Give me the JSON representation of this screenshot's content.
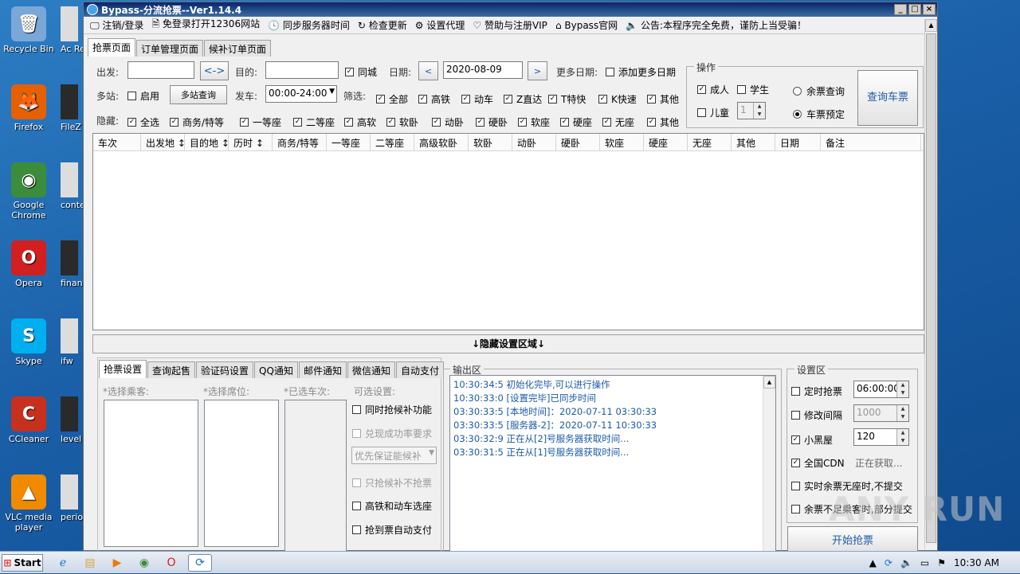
{
  "desktop": {
    "icons": [
      {
        "label": "Recycle Bin",
        "icon": "recycle-bin-icon",
        "color": "#7aa7d8",
        "glyph": "🗑"
      },
      {
        "label": "Firefox",
        "icon": "firefox-icon",
        "color": "#e66000",
        "glyph": "🦊"
      },
      {
        "label": "Google Chrome",
        "icon": "chrome-icon",
        "color": "#3b8d3b",
        "glyph": "◉"
      },
      {
        "label": "Opera",
        "icon": "opera-icon",
        "color": "#d21f1f",
        "glyph": "O"
      },
      {
        "label": "Skype",
        "icon": "skype-icon",
        "color": "#00aff0",
        "glyph": "S"
      },
      {
        "label": "CCleaner",
        "icon": "ccleaner-icon",
        "color": "#c8301e",
        "glyph": "C"
      },
      {
        "label": "VLC media player",
        "icon": "vlc-icon",
        "color": "#f08a00",
        "glyph": "▲"
      }
    ],
    "icons2": [
      "Ac Rea",
      "FileZ",
      "conte",
      "financ",
      "ifw",
      "level",
      "period"
    ]
  },
  "window": {
    "title": "Bypass-分流抢票--Ver1.14.4",
    "controls": [
      "_",
      "□",
      "×"
    ]
  },
  "menu": [
    "注销/登录",
    "免登录打开12306网站",
    "同步服务器时间",
    "检查更新",
    "设置代理",
    "赞助与注册VIP",
    "Bypass官网",
    "公告:本程序完全免费，谨防上当受骗！"
  ],
  "tabs": [
    "抢票页面",
    "订单管理页面",
    "候补订单页面"
  ],
  "form": {
    "from_label": "出发:",
    "to_label": "目的:",
    "swap": "<->",
    "same_city": "同城",
    "date_label": "日期:",
    "date_value": "2020-08-09",
    "prev": "<",
    "next": ">",
    "more_dates": "更多日期:",
    "add_dates": "添加更多日期",
    "multi_label": "多站:",
    "multi_enable": "启用",
    "multi_query": "多站查询",
    "depart_label": "发车:",
    "depart_value": "00:00-24:00",
    "filter_label": "筛选:",
    "hide_label": "隐藏:"
  },
  "filters": [
    {
      "t": "全部",
      "on": true
    },
    {
      "t": "高铁",
      "on": true
    },
    {
      "t": "动车",
      "on": true
    },
    {
      "t": "Z直达",
      "on": true
    },
    {
      "t": "T特快",
      "on": true
    },
    {
      "t": "K快速",
      "on": true
    },
    {
      "t": "其他",
      "on": true
    }
  ],
  "hides": [
    {
      "t": "全选",
      "on": true
    },
    {
      "t": "商务/特等",
      "on": true
    },
    {
      "t": "一等座",
      "on": true
    },
    {
      "t": "二等座",
      "on": true
    },
    {
      "t": "高软",
      "on": true
    },
    {
      "t": "软卧",
      "on": true
    },
    {
      "t": "动卧",
      "on": true
    },
    {
      "t": "硬卧",
      "on": true
    },
    {
      "t": "软座",
      "on": true
    },
    {
      "t": "硬座",
      "on": true
    },
    {
      "t": "无座",
      "on": true
    },
    {
      "t": "其他",
      "on": true
    }
  ],
  "ops": {
    "title": "操作",
    "adult": "成人",
    "student": "学生",
    "child": "儿童",
    "child_count": "1",
    "remain_query": "余票查询",
    "booking": "车票预定",
    "query_btn": "查询车票"
  },
  "columns": [
    "车次",
    "出发地 ↕",
    "目的地 ↕",
    "历时 ↕",
    "商务/特等",
    "一等座",
    "二等座",
    "高级软卧",
    "软卧",
    "动卧",
    "硬卧",
    "软座",
    "硬座",
    "无座",
    "其他",
    "日期",
    "备注"
  ],
  "hidebar": "↓隐藏设置区域↓",
  "subtabs": [
    "抢票设置",
    "查询起售",
    "验证码设置",
    "QQ通知",
    "邮件通知",
    "微信通知",
    "自动支付"
  ],
  "settings": {
    "passenger": "*选择乘客:",
    "seat": "*选择席位:",
    "selected": "*已选车次:",
    "optional": "可选设置:",
    "opt_items": [
      {
        "t": "同时抢候补功能",
        "en": true
      },
      {
        "t": "兑现成功率要求",
        "en": false
      },
      {
        "t": "只抢候补不抢票",
        "en": false
      },
      {
        "t": "高铁和动车选座",
        "en": true
      },
      {
        "t": "抢到票自动支付",
        "en": true
      }
    ],
    "priority": "优先保证能候补"
  },
  "output": {
    "title": "输出区",
    "lines": [
      "10:30:34:5  初始化完毕,可以进行操作",
      "10:30:33:0  [设置完毕]已同步时间",
      "03:30:33:5  [本地时间]：2020-07-11 03:30:33",
      "03:30:33:5  [服务器-2]：2020-07-11 10:30:33",
      "03:30:32:9  正在从[2]号服务器获取时间...",
      "03:30:31:5  正在从[1]号服务器获取时间..."
    ]
  },
  "settings_area": {
    "title": "设置区",
    "timed": "定时抢票",
    "timed_val": "06:00:00",
    "interval": "修改间隔",
    "interval_val": "1000",
    "blackroom": "小黑屋",
    "blackroom_val": "120",
    "cdn": "全国CDN",
    "cdn_status": "正在获取...",
    "no_seat": "实时余票无座时,不提交",
    "partial": "余票不足乘客时,部分提交",
    "start": "开始抢票"
  },
  "taskbar": {
    "start": "Start",
    "clock": "10:30 AM"
  },
  "watermark": "ANY RUN"
}
